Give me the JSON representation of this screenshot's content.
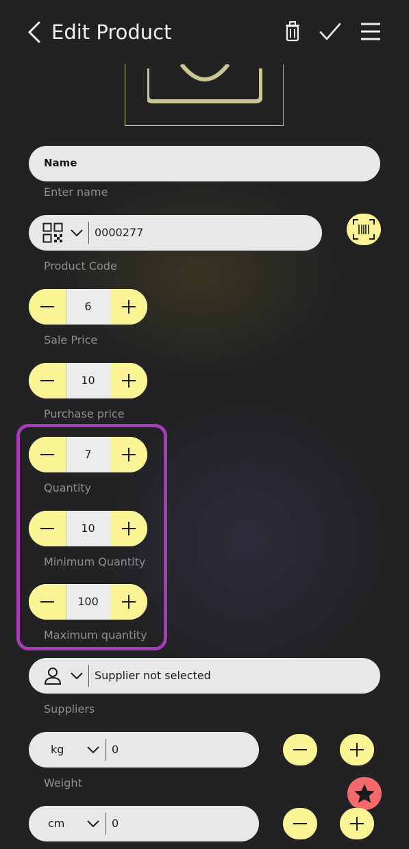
{
  "header": {
    "title": "Edit Product"
  },
  "form": {
    "name": {
      "value": "Name",
      "label": "Enter name"
    },
    "product_code": {
      "value": "0000277",
      "label": "Product Code"
    },
    "sale_price": {
      "value": "6",
      "label": "Sale Price"
    },
    "purchase_price": {
      "value": "10",
      "label": "Purchase price"
    },
    "quantity": {
      "value": "7",
      "label": "Quantity"
    },
    "minimum_quantity": {
      "value": "10",
      "label": "Minimum Quantity"
    },
    "maximum_quantity": {
      "value": "100",
      "label": "Maximum quantity"
    },
    "supplier": {
      "value": "Supplier not selected",
      "label": "Suppliers"
    },
    "weight": {
      "unit": "kg",
      "value": "0",
      "label": "Weight"
    },
    "size": {
      "unit": "cm",
      "value": "0"
    }
  },
  "colors": {
    "background": "#222224",
    "accent_yellow": "#fbf494",
    "highlight_purple": "#a73cb6",
    "favorite_red": "#f56a6a"
  },
  "icons": [
    "back-icon",
    "trash-icon",
    "check-icon",
    "menu-icon",
    "camera-icon",
    "qr-code-icon",
    "chevron-down-icon",
    "barcode-scan-icon",
    "minus-icon",
    "plus-icon",
    "person-icon",
    "star-icon"
  ]
}
